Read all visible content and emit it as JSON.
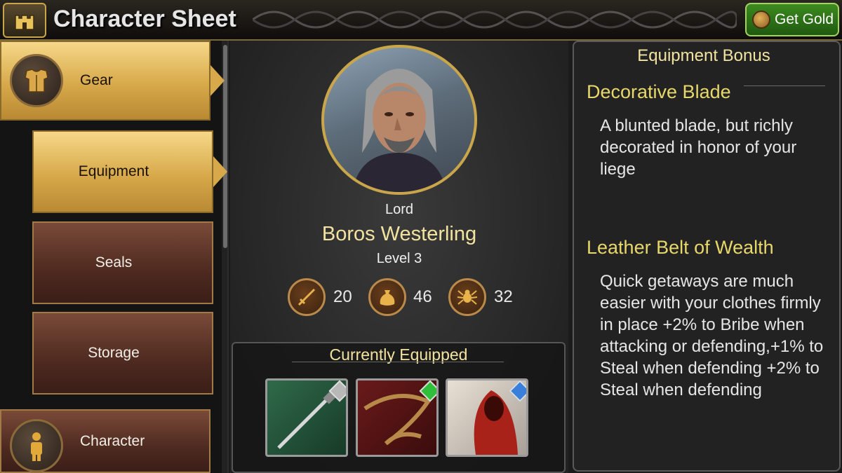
{
  "header": {
    "title": "Character Sheet",
    "get_gold_label": "Get Gold"
  },
  "sidebar": {
    "items": [
      {
        "label": "Gear",
        "icon": "armor-icon",
        "selected": true
      },
      {
        "label": "Equipment",
        "selected": true
      },
      {
        "label": "Seals"
      },
      {
        "label": "Storage"
      },
      {
        "label": "Character",
        "icon": "person-icon"
      }
    ]
  },
  "character": {
    "rank": "Lord",
    "name": "Boros Westerling",
    "level": "Level 3",
    "stats": [
      {
        "icon": "sword-icon",
        "value": "20"
      },
      {
        "icon": "money-bag-icon",
        "value": "46"
      },
      {
        "icon": "spider-icon",
        "value": "32"
      }
    ]
  },
  "equipped": {
    "title": "Currently Equipped",
    "slots": [
      {
        "icon": "blade-icon",
        "gem_color": "#b8b8b8"
      },
      {
        "icon": "belt-icon",
        "gem_color": "#2fbf3a"
      },
      {
        "icon": "hooded-cloak-icon",
        "gem_color": "#3a7fd9"
      }
    ]
  },
  "bonus": {
    "title": "Equipment Bonus",
    "items": [
      {
        "name": "Decorative Blade",
        "description": "A blunted blade, but richly decorated in honor of your liege"
      },
      {
        "name": "Leather Belt of Wealth",
        "description": "Quick getaways are much easier with your clothes firmly in place +2% to Bribe when attacking or defending,+1% to Steal when defending +2% to Steal when defending"
      }
    ]
  },
  "colors": {
    "accent_gold": "#c9a64a",
    "title_yellow": "#f2e3a0",
    "get_gold_green": "#3d8a1f"
  }
}
